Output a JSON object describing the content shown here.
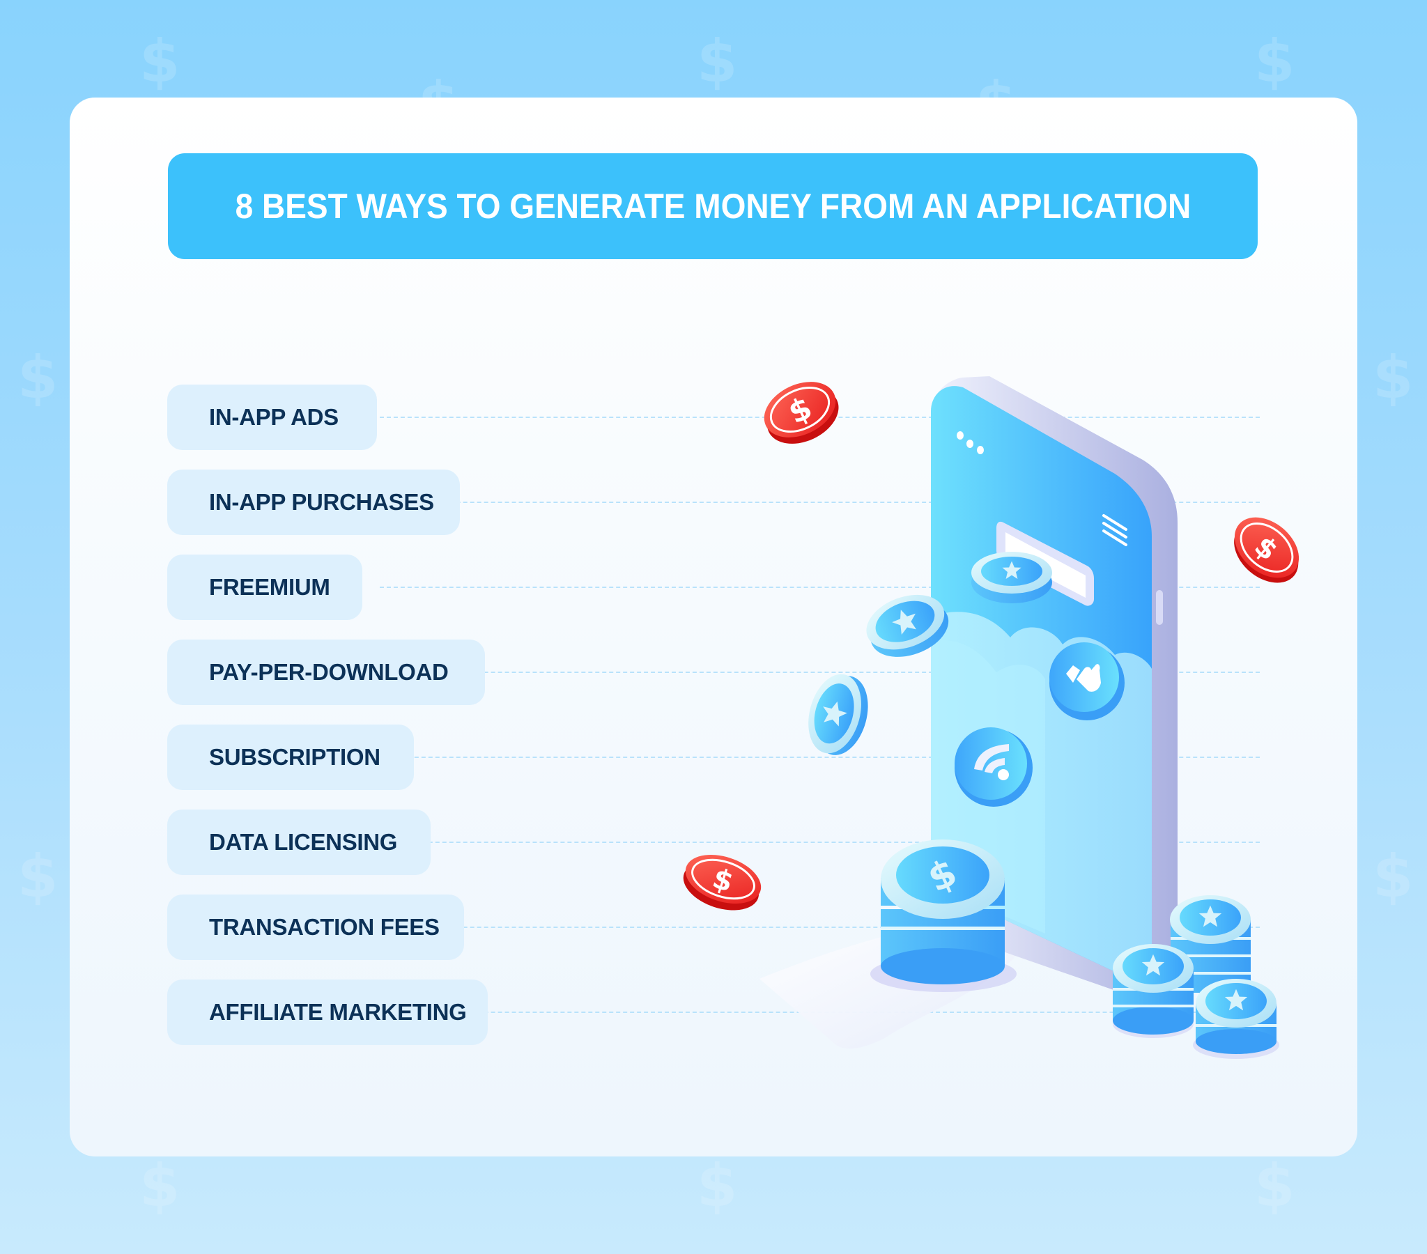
{
  "title": "8 BEST WAYS TO GENERATE MONEY FROM AN APPLICATION",
  "methods": [
    {
      "label": "IN-APP ADS"
    },
    {
      "label": "IN-APP PURCHASES"
    },
    {
      "label": "FREEMIUM"
    },
    {
      "label": "PAY-PER-DOWNLOAD"
    },
    {
      "label": "SUBSCRIPTION"
    },
    {
      "label": "DATA LICENSING"
    },
    {
      "label": "TRANSACTION FEES"
    },
    {
      "label": "AFFILIATE MARKETING"
    }
  ],
  "watermark_symbol": "$",
  "colors": {
    "background_top": "#89d3fd",
    "background_bottom": "#c8eafd",
    "title_bar": "#3cc1fb",
    "title_text": "#ffffff",
    "label_box": "#ddf0fd",
    "label_text": "#0c3157",
    "dash_line": "#b9e2fb",
    "coin_blue": "#45aefb",
    "coin_red": "#e52a2a"
  },
  "illustration": {
    "phone_icons": [
      "more-dots-icon",
      "hamburger-menu-icon",
      "thumbs-up-icon",
      "wifi-icon"
    ],
    "coin_symbols": [
      "star",
      "dollar"
    ]
  }
}
